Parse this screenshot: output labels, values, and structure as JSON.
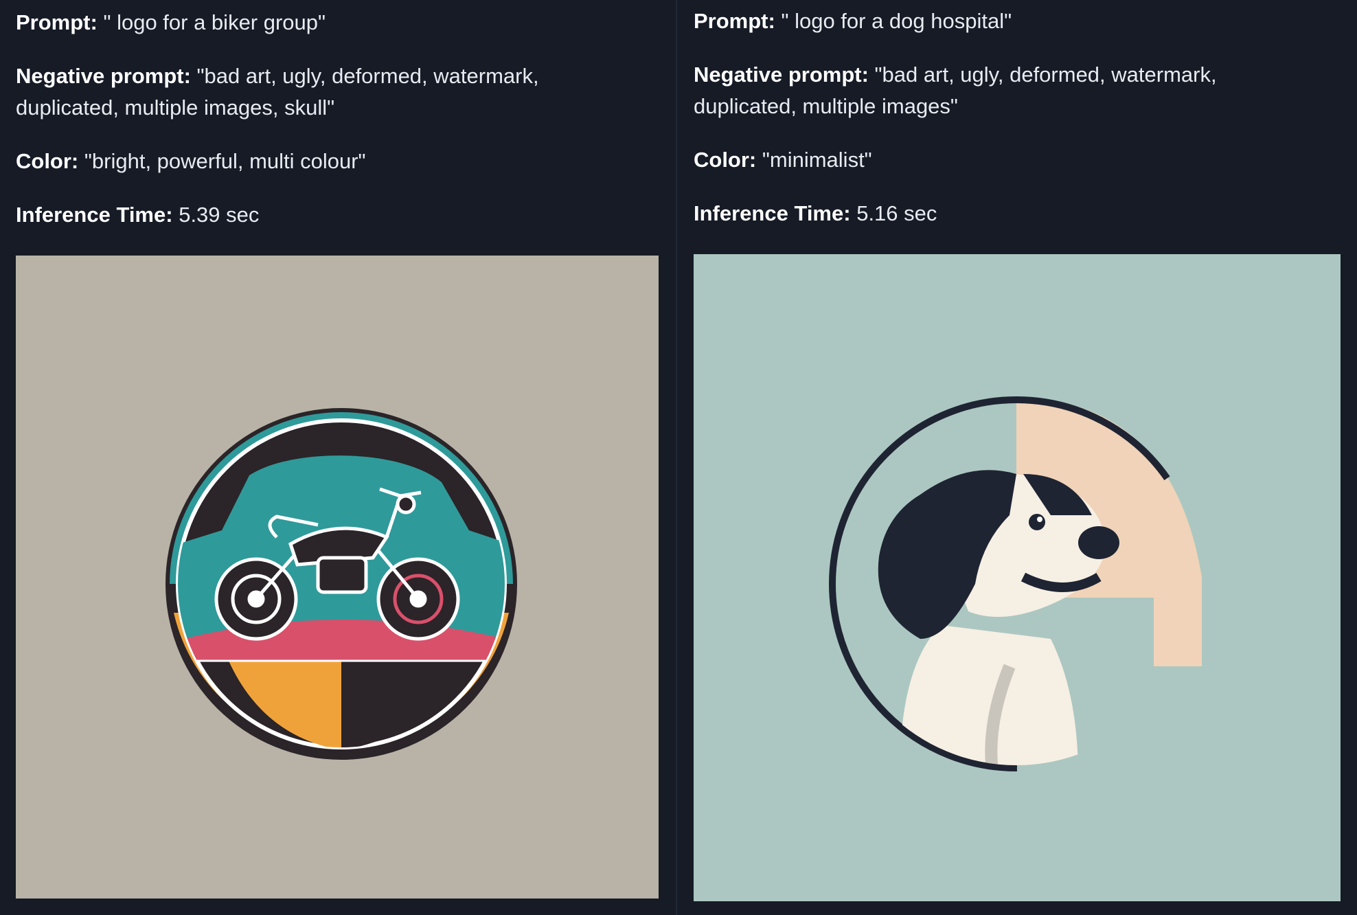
{
  "left": {
    "prompt_label": "Prompt:",
    "prompt_value": "\" logo for a biker group\"",
    "negative_label": "Negative prompt:",
    "negative_value_line1": "\"bad art, ugly, deformed, watermark,",
    "negative_value_line2": "duplicated, multiple images, skull\"",
    "color_label": "Color:",
    "color_value": "\"bright, powerful, multi colour\"",
    "time_label": "Inference Time:",
    "time_value": "5.39 sec",
    "image_icon": "motorcycle-logo",
    "image_background": "#b8b3a6"
  },
  "right": {
    "prompt_label": "Prompt:",
    "prompt_value": "\" logo for a dog hospital\"",
    "negative_label": "Negative prompt:",
    "negative_value_line1": "\"bad art, ugly, deformed, watermark,",
    "negative_value_line2": "duplicated, multiple images\"",
    "color_label": "Color:",
    "color_value": "\"minimalist\"",
    "time_label": "Inference Time:",
    "time_value": "5.16 sec",
    "image_icon": "dog-logo",
    "image_background": "#acc7c1"
  },
  "colors": {
    "page_background": "#161b26",
    "teal": "#2f9a9a",
    "pink": "#d9506b",
    "orange": "#f0a23a",
    "dark": "#2b2428",
    "peach": "#f0d3b8"
  }
}
